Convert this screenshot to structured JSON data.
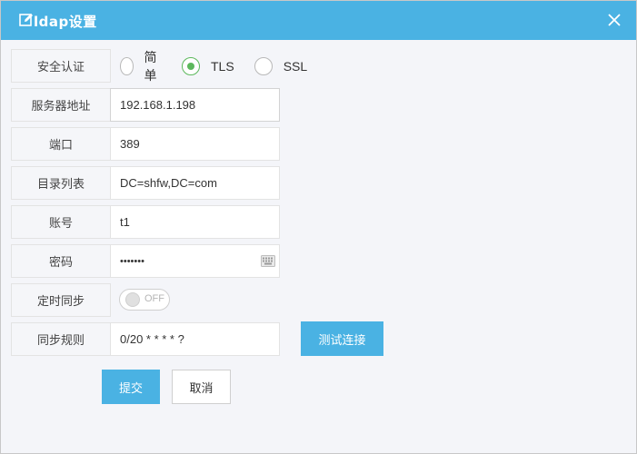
{
  "dialog": {
    "title": "ldap设置",
    "title_icon": "edit-icon",
    "close_icon": "close-icon"
  },
  "colors": {
    "accent": "#4ab2e3",
    "radio_checked": "#5cb85c"
  },
  "form": {
    "auth": {
      "label": "安全认证",
      "options": [
        {
          "label": "简单",
          "checked": false
        },
        {
          "label": "TLS",
          "checked": true
        },
        {
          "label": "SSL",
          "checked": false
        }
      ]
    },
    "server": {
      "label": "服务器地址",
      "value": "192.168.1.198"
    },
    "port": {
      "label": "端口",
      "value": "389"
    },
    "directory": {
      "label": "目录列表",
      "value": "DC=shfw,DC=com"
    },
    "account": {
      "label": "账号",
      "value": "t1"
    },
    "password": {
      "label": "密码",
      "value": "•••••••",
      "icon": "keyboard-icon"
    },
    "sync": {
      "label": "定时同步",
      "toggle_text": "OFF",
      "enabled": false
    },
    "rule": {
      "label": "同步规则",
      "value": "0/20 * * * * ?"
    }
  },
  "buttons": {
    "test": "测试连接",
    "submit": "提交",
    "cancel": "取消"
  }
}
